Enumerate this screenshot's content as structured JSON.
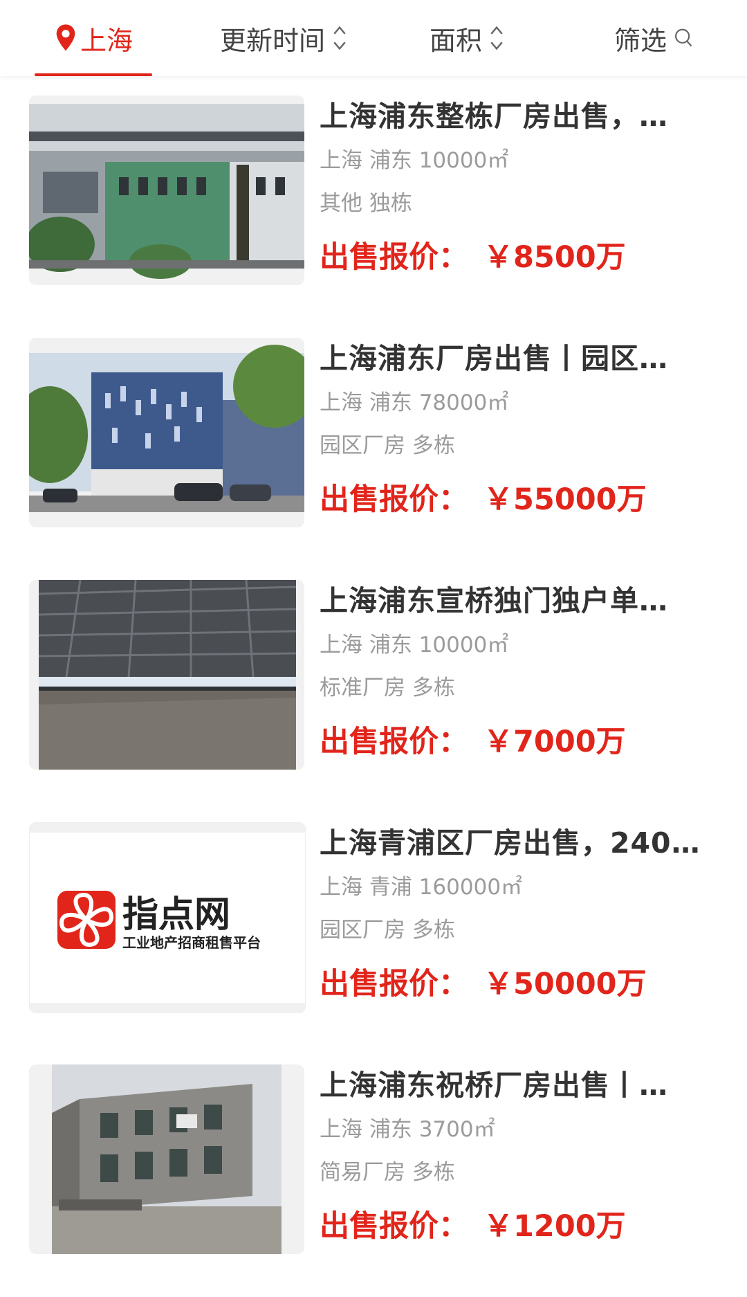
{
  "topbar": {
    "city": "上海",
    "sort_update_time": "更新时间",
    "sort_area": "面积",
    "filter": "筛选",
    "accent_color": "#e1251b",
    "icons": [
      "location-pin-icon",
      "sort-updown-icon",
      "search-icon"
    ]
  },
  "listings": [
    {
      "title": "上海浦东整栋厂房出售，…",
      "location": "上海 浦东 10000㎡",
      "tags": "其他 独栋",
      "price_label": "出售报价：",
      "price": "￥8500万"
    },
    {
      "title": "上海浦东厂房出售丨园区…",
      "location": "上海 浦东 78000㎡",
      "tags": "园区厂房 多栋",
      "price_label": "出售报价：",
      "price": "￥55000万"
    },
    {
      "title": "上海浦东宣桥独门独户单…",
      "location": "上海 浦东 10000㎡",
      "tags": "标准厂房 多栋",
      "price_label": "出售报价：",
      "price": "￥7000万"
    },
    {
      "title": "上海青浦区厂房出售，240…",
      "location": "上海 青浦 160000㎡",
      "tags": "园区厂房 多栋",
      "price_label": "出售报价：",
      "price": "￥50000万",
      "logo": {
        "brand": "指点网",
        "slogan": "工业地产招商租售平台"
      }
    },
    {
      "title": "上海浦东祝桥厂房出售丨…",
      "location": "上海 浦东 3700㎡",
      "tags": "简易厂房 多栋",
      "price_label": "出售报价：",
      "price": "￥1200万"
    }
  ]
}
